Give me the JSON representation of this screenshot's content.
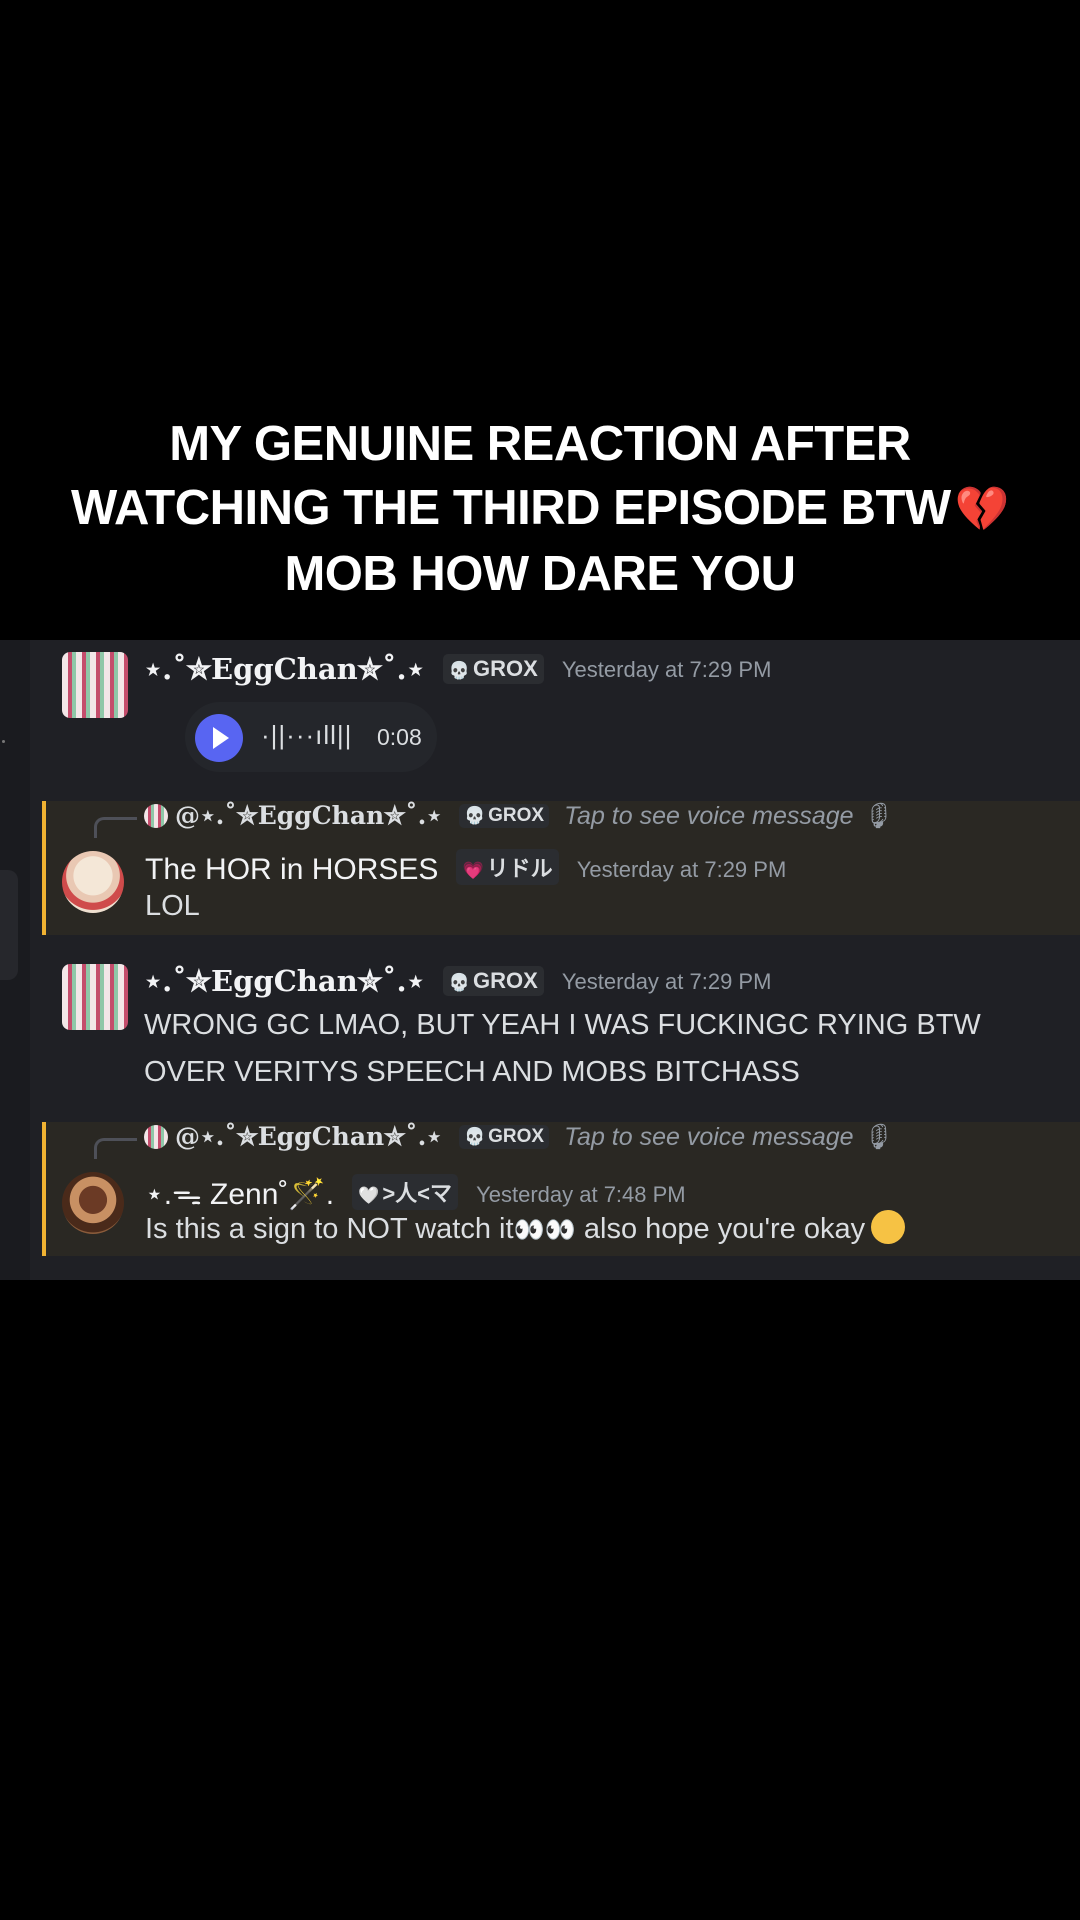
{
  "caption": {
    "line1": "MY GENUINE REACTION AFTER",
    "line2": "WATCHING THE THIRD EPISODE BTW",
    "line2_emoji": "💔",
    "line3": "MOB HOW DARE YOU"
  },
  "messages": [
    {
      "author": "⋆.˚✮EggChan✮˚.⋆",
      "tag_icon": "💀",
      "tag": "GROX",
      "timestamp": "Yesterday at 7:29 PM",
      "voice": {
        "waveform": "·||···ıll||",
        "duration": "0:08"
      }
    },
    {
      "reply_to": "@⋆.˚✮EggChan✮˚.⋆",
      "reply_tag": "GROX",
      "reply_preview": "Tap to see voice message 🎙",
      "author": "The HOR in HORSES",
      "tag_icon": "💗",
      "tag": "リドル",
      "timestamp": "Yesterday at 7:29 PM",
      "text": "LOL"
    },
    {
      "author": "⋆.˚✮EggChan✮˚.⋆",
      "tag_icon": "💀",
      "tag": "GROX",
      "timestamp": "Yesterday at 7:29 PM",
      "text_line1": "WRONG GC LMAO, BUT YEAH I WAS FUCKINGC RYING BTW",
      "text_line2": "OVER VERITYS SPEECH AND MOBS BITCHASS"
    },
    {
      "reply_to": "@⋆.˚✮EggChan✮˚.⋆",
      "reply_tag": "GROX",
      "reply_preview": "Tap to see voice message 🎙",
      "author": "⋆.ᯓ Zenn˚🪄.",
      "tag_icon": "🤍",
      "tag": ">人<マ",
      "timestamp": "Yesterday at 7:48 PM",
      "text_a": "Is this a sign to NOT watch it",
      "text_emoji": "👀👀",
      "text_b": " also hope you're okay"
    }
  ]
}
